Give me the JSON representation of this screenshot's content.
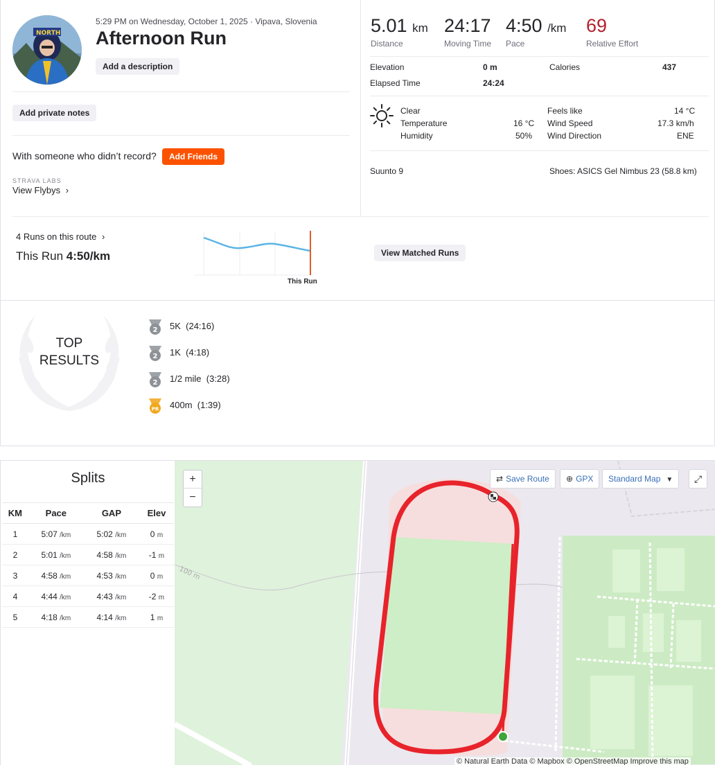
{
  "activity": {
    "meta": "5:29 PM on Wednesday, October 1, 2025 · Vipava, Slovenia",
    "title": "Afternoon Run",
    "add_description": "Add a description",
    "add_private_notes": "Add private notes",
    "with_someone": "With someone who didn’t record?",
    "add_friends": "Add Friends",
    "labs_label": "STRAVA LABS",
    "view_flybys": "View Flybys",
    "view_flybys_chevron": "›"
  },
  "stats": {
    "distance": {
      "value": "5.01",
      "unit": "km",
      "label": "Distance"
    },
    "moving_time": {
      "value": "24:17",
      "label": "Moving Time"
    },
    "pace": {
      "value": "4:50",
      "unit": "/km",
      "label": "Pace"
    },
    "relative_effort": {
      "value": "69",
      "label": "Relative Effort"
    }
  },
  "details": {
    "elevation_label": "Elevation",
    "elevation": "0 m",
    "calories_label": "Calories",
    "calories": "437",
    "elapsed_label": "Elapsed Time",
    "elapsed": "24:24"
  },
  "weather": {
    "condition": "Clear",
    "temperature_label": "Temperature",
    "temperature": "16 °C",
    "humidity_label": "Humidity",
    "humidity": "50%",
    "feels_like_label": "Feels like",
    "feels_like": "14 °C",
    "wind_speed_label": "Wind Speed",
    "wind_speed": "17.3 km/h",
    "wind_dir_label": "Wind Direction",
    "wind_dir": "ENE"
  },
  "gear": {
    "device": "Suunto 9",
    "shoes": "Shoes: ASICS Gel Nimbus 23 (58.8 km)"
  },
  "route": {
    "runs_on_route": "4 Runs on this route",
    "chevron": "›",
    "this_run_prefix": "This Run ",
    "this_run_pace": "4:50/km",
    "chart_label": "This Run",
    "view_matched": "View Matched Runs"
  },
  "top_results": {
    "title_line1": "TOP",
    "title_line2": "RESULTS",
    "items": [
      {
        "name": "5K",
        "time": "(24:16)",
        "medal": "2"
      },
      {
        "name": "1K",
        "time": "(4:18)",
        "medal": "2"
      },
      {
        "name": "1/2 mile",
        "time": "(3:28)",
        "medal": "2"
      },
      {
        "name": "400m",
        "time": "(1:39)",
        "medal": "PR"
      }
    ]
  },
  "splits": {
    "title": "Splits",
    "headers": [
      "KM",
      "Pace",
      "GAP",
      "Elev"
    ],
    "unit": "/km",
    "rows": [
      {
        "km": "1",
        "pace": "5:07",
        "gap": "5:02",
        "elev": "0",
        "elev_unit": "m"
      },
      {
        "km": "2",
        "pace": "5:01",
        "gap": "4:58",
        "elev": "-1",
        "elev_unit": "m"
      },
      {
        "km": "3",
        "pace": "4:58",
        "gap": "4:53",
        "elev": "0",
        "elev_unit": "m"
      },
      {
        "km": "4",
        "pace": "4:44",
        "gap": "4:43",
        "elev": "-2",
        "elev_unit": "m"
      },
      {
        "km": "5",
        "pace": "4:18",
        "gap": "4:14",
        "elev": "1",
        "elev_unit": "m"
      }
    ]
  },
  "map": {
    "zoom_in": "+",
    "zoom_out": "−",
    "save_route": "Save Route",
    "gpx": "GPX",
    "map_style": "Standard Map",
    "contour_label": "100 m",
    "attribution": "© Natural Earth Data © Mapbox © OpenStreetMap Improve this map"
  },
  "colors": {
    "brand_orange": "#fc5200",
    "effort_red": "#b4212c",
    "route_red": "#e8232b",
    "chart_blue": "#5bb4e5"
  }
}
